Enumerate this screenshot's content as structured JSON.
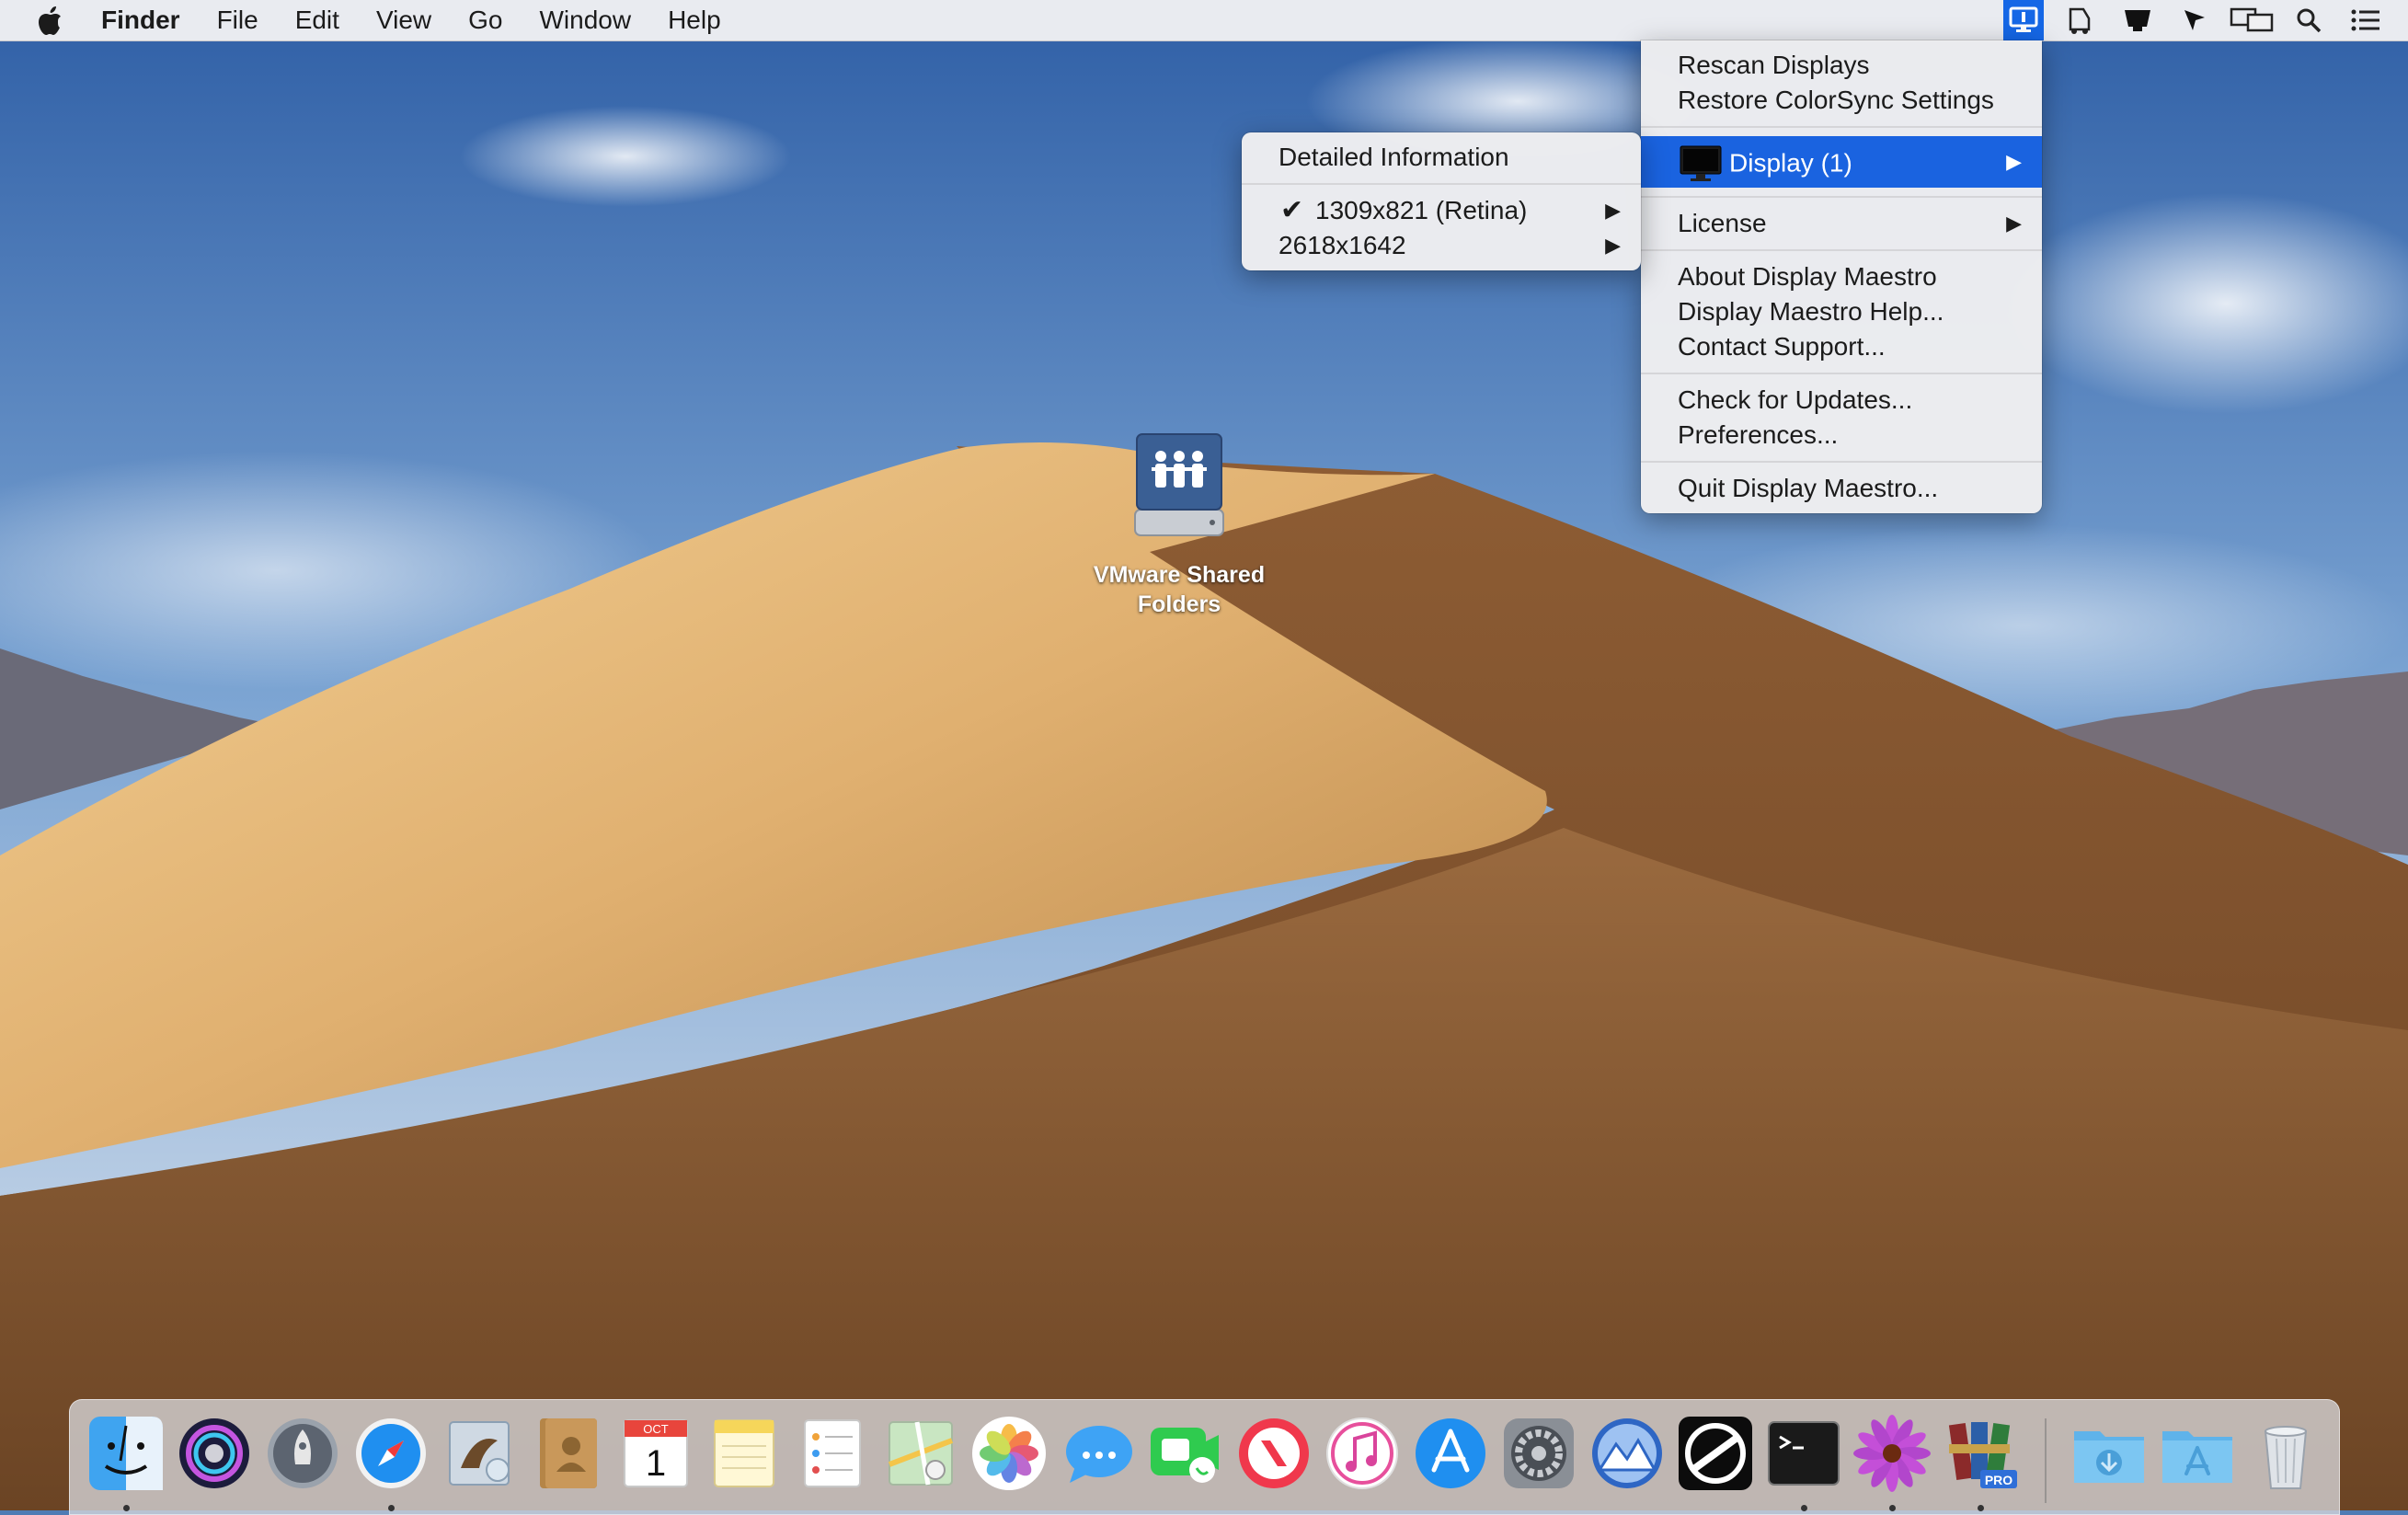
{
  "menubar": {
    "apple_icon": "apple-logo-icon",
    "app_name": "Finder",
    "items": [
      {
        "label": "File"
      },
      {
        "label": "Edit"
      },
      {
        "label": "View"
      },
      {
        "label": "Go"
      },
      {
        "label": "Window"
      },
      {
        "label": "Help"
      }
    ],
    "status_icons": [
      "display-maestro-icon",
      "printer-icon",
      "bell-icon",
      "location-cursor-icon",
      "airplay-display-icon",
      "spotlight-search-icon",
      "notification-center-icon"
    ]
  },
  "main_menu": {
    "items": {
      "rescan": "Rescan Displays",
      "restore": "Restore ColorSync Settings",
      "display": "Display (1)",
      "license": "License",
      "about": "About Display Maestro",
      "help": "Display Maestro Help...",
      "contact": "Contact Support...",
      "updates": "Check for Updates...",
      "preferences": "Preferences...",
      "quit": "Quit Display Maestro..."
    }
  },
  "sub_menu": {
    "detailed": "Detailed Information",
    "res_current": "1309x821 (Retina)",
    "res_other": "2618x1642"
  },
  "desktop": {
    "icon_label_line1": "VMware Shared",
    "icon_label_line2": "Folders"
  },
  "dock": {
    "apps": [
      {
        "name": "finder-icon",
        "running": true
      },
      {
        "name": "siri-icon",
        "running": false
      },
      {
        "name": "launchpad-icon",
        "running": false
      },
      {
        "name": "safari-icon",
        "running": true
      },
      {
        "name": "mail-icon",
        "running": false
      },
      {
        "name": "contacts-icon",
        "running": false
      },
      {
        "name": "calendar-icon",
        "running": false,
        "month": "OCT",
        "day": "1"
      },
      {
        "name": "notes-icon",
        "running": false
      },
      {
        "name": "reminders-icon",
        "running": false
      },
      {
        "name": "maps-icon",
        "running": false
      },
      {
        "name": "photos-icon",
        "running": false
      },
      {
        "name": "messages-icon",
        "running": false
      },
      {
        "name": "facetime-icon",
        "running": false
      },
      {
        "name": "news-icon",
        "running": false
      },
      {
        "name": "itunes-icon",
        "running": false
      },
      {
        "name": "app-store-icon",
        "running": false
      },
      {
        "name": "system-preferences-icon",
        "running": false
      },
      {
        "name": "display-maestro-icon",
        "running": false
      },
      {
        "name": "navigator-icon",
        "running": false
      },
      {
        "name": "terminal-icon",
        "running": true
      },
      {
        "name": "flower-app-icon",
        "running": true
      },
      {
        "name": "winrar-pro-icon",
        "running": true,
        "badge": "PRO"
      }
    ],
    "folders": [
      "downloads-folder-icon",
      "applications-folder-icon"
    ],
    "trash": "trash-icon"
  }
}
